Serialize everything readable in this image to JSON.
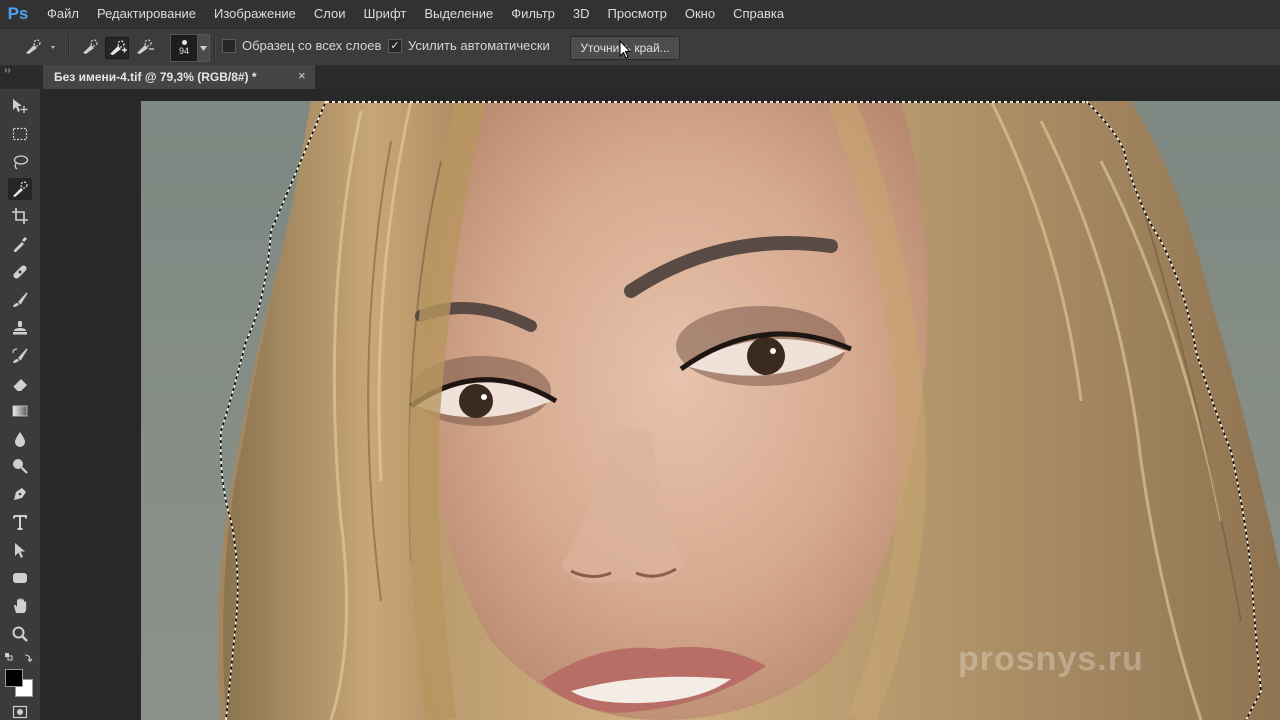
{
  "app": {
    "logo": "Ps"
  },
  "menu": [
    "Файл",
    "Редактирование",
    "Изображение",
    "Слои",
    "Шрифт",
    "Выделение",
    "Фильтр",
    "3D",
    "Просмотр",
    "Окно",
    "Справка"
  ],
  "options": {
    "brush_size": "94",
    "sample_all_layers": {
      "label": "Образец со всех слоев",
      "checked": false
    },
    "auto_enhance": {
      "label": "Усилить автоматически",
      "checked": true
    },
    "refine_edge": "Уточнить край..."
  },
  "document": {
    "tab_title": "Без имени-4.tif @ 79,3% (RGB/8#) *",
    "close": "×"
  },
  "canvas": {
    "watermark": "prosnys.ru"
  },
  "tools": [
    "move-icon",
    "marquee-icon",
    "lasso-icon",
    "quick-selection-icon",
    "crop-icon",
    "eyedropper-icon",
    "healing-brush-icon",
    "brush-icon",
    "clone-stamp-icon",
    "history-brush-icon",
    "eraser-icon",
    "gradient-icon",
    "blur-icon",
    "dodge-icon",
    "pen-icon",
    "type-icon",
    "path-selection-icon",
    "shape-icon",
    "hand-icon",
    "zoom-icon"
  ],
  "colors": {
    "foreground": "#000000",
    "background": "#ffffff",
    "accent": "#4da3f2"
  }
}
